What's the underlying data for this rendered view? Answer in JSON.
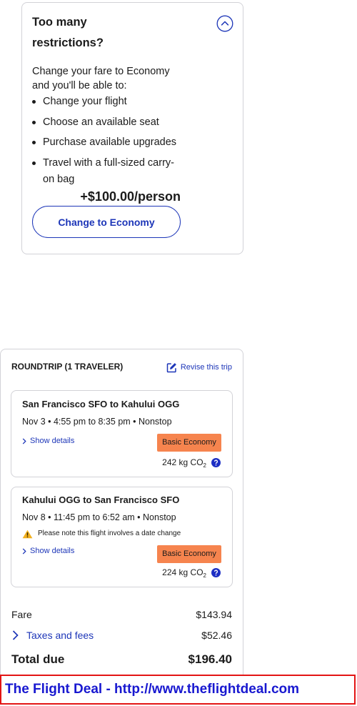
{
  "colors": {
    "link": "#1d36b8",
    "text": "#1b1b1b",
    "border": "#d2d2d7",
    "badge": "#f6844e",
    "help": "#1d2fc4",
    "warning": "#f2b01e",
    "banner_border": "#e31414",
    "banner_text": "#1818d0"
  },
  "icons": {
    "upsell_toggle": "chevron-up-icon",
    "revise_trip": "edit-icon",
    "show_details": "chevron-right-icon",
    "emissions_help": "help-circle-icon",
    "date_change_notice": "warning-icon",
    "taxes_expand": "chevron-right-icon"
  },
  "upsell": {
    "title": "Too many restrictions?",
    "intro": "Change your fare to Economy and you'll be able to:",
    "benefits": [
      "Change your flight",
      "Choose an available seat",
      "Purchase available upgrades",
      "Travel with a full-sized carry-on bag"
    ],
    "price": "+$100.00/person",
    "button_label": "Change to Economy"
  },
  "trip": {
    "heading": "ROUNDTRIP (1 TRAVELER)",
    "revise_label": "Revise this trip",
    "flights": [
      {
        "route": "San Francisco SFO to Kahului OGG",
        "schedule": "Nov 3 • 4:55 pm to 8:35 pm • Nonstop",
        "details_label": "Show details",
        "fare_class": "Basic Economy",
        "emissions": {
          "amount": "242 kg",
          "gas": "CO",
          "gas_subscript": "2"
        }
      },
      {
        "route": "Kahului OGG to San Francisco SFO",
        "schedule": "Nov 8 • 11:45 pm to 6:52 am • Nonstop",
        "notice": "Please note this flight involves a date change",
        "details_label": "Show details",
        "fare_class": "Basic Economy",
        "emissions": {
          "amount": "224 kg",
          "gas": "CO",
          "gas_subscript": "2"
        }
      }
    ],
    "price_summary": {
      "fare_label": "Fare",
      "fare_amount": "$143.94",
      "taxes_label": "Taxes and fees",
      "taxes_amount": "$52.46",
      "total_label": "Total due",
      "total_amount": "$196.40"
    }
  },
  "banner": {
    "text": "The Flight Deal - http://www.theflightdeal.com"
  }
}
